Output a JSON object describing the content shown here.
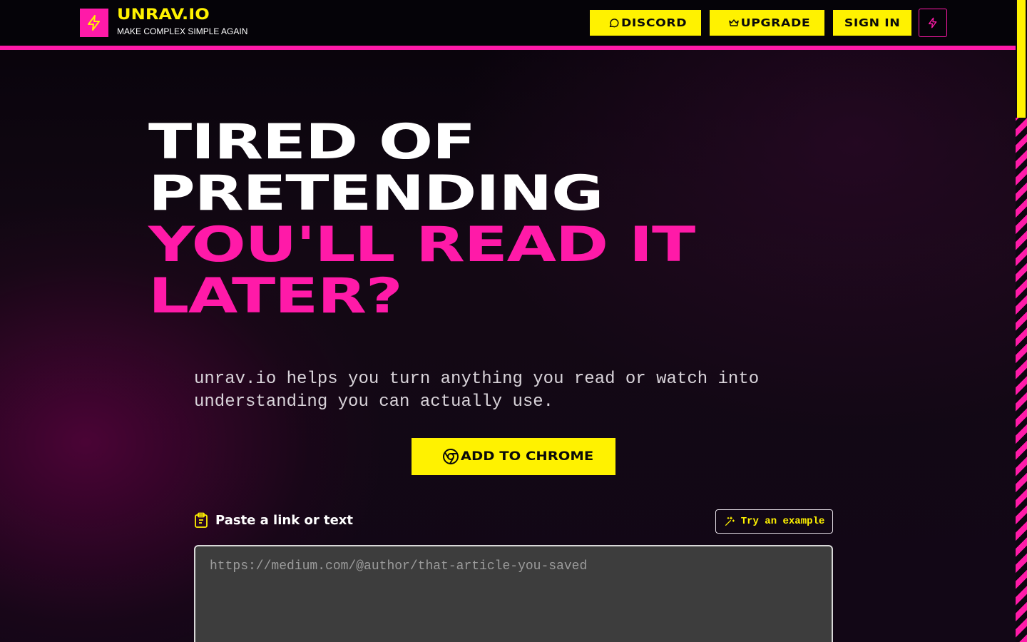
{
  "header": {
    "brand_name": "UNRAV.IO",
    "tagline": "MAKE COMPLEX SIMPLE AGAIN",
    "nav": {
      "discord": "DISCORD",
      "upgrade": "UPGRADE",
      "signin": "SIGN IN"
    }
  },
  "hero": {
    "line1": "TIRED OF",
    "line2": "PRETENDING",
    "line3": "YOU'LL READ IT",
    "line4": "LATER?"
  },
  "subtitle": "unrav.io helps you turn anything you read or watch into understanding you can actually use.",
  "cta": {
    "label": "ADD TO CHROME"
  },
  "input": {
    "label": "Paste a link or text",
    "try_example": "Try an example",
    "placeholder": "https://medium.com/@author/that-article-you-saved",
    "value": ""
  },
  "icons": {
    "logo": "lightning-bolt-icon",
    "discord": "chat-bubble-icon",
    "upgrade": "crown-icon",
    "menu": "lightning-bolt-icon",
    "cta": "chrome-icon",
    "paste": "clipboard-icon",
    "try": "sparkle-wand-icon"
  },
  "colors": {
    "accent_pink": "#ff1aa8",
    "accent_yellow": "#fff200",
    "background": "#0d0610"
  }
}
